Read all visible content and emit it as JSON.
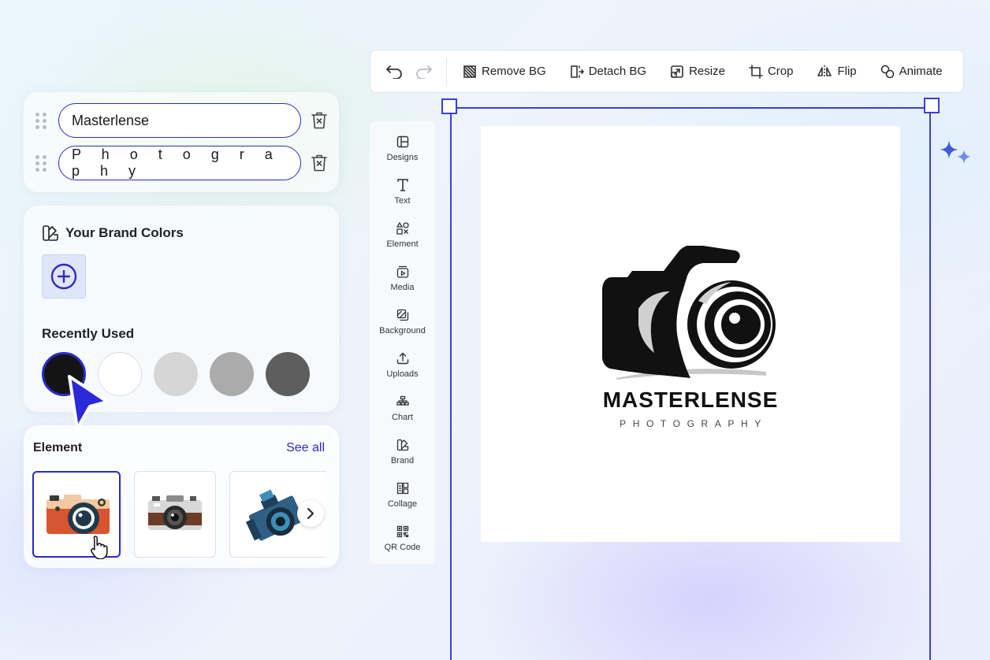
{
  "layers": {
    "items": [
      {
        "text": "Masterlense"
      },
      {
        "text": "P h o t o g r a p h y"
      }
    ]
  },
  "brand": {
    "title": "Your Brand Colors",
    "recent_title": "Recently Used",
    "recent_colors": [
      "#141414",
      "#ffffff",
      "#d6d6d6",
      "#ababab",
      "#5e5e5e"
    ]
  },
  "elements": {
    "title": "Element",
    "see_all": "See all"
  },
  "toolbar": {
    "remove_bg": "Remove BG",
    "detach_bg": "Detach BG",
    "resize": "Resize",
    "crop": "Crop",
    "flip": "Flip",
    "animate": "Animate"
  },
  "rail": {
    "items": [
      {
        "label": "Designs",
        "icon": "layout-icon"
      },
      {
        "label": "Text",
        "icon": "text-icon"
      },
      {
        "label": "Element",
        "icon": "shapes-icon"
      },
      {
        "label": "Media",
        "icon": "media-icon"
      },
      {
        "label": "Background",
        "icon": "background-icon"
      },
      {
        "label": "Uploads",
        "icon": "upload-icon"
      },
      {
        "label": "Chart",
        "icon": "chart-icon"
      },
      {
        "label": "Brand",
        "icon": "brand-icon"
      },
      {
        "label": "Collage",
        "icon": "collage-icon"
      },
      {
        "label": "QR Code",
        "icon": "qr-code-icon"
      }
    ]
  },
  "canvas": {
    "logo_title": "MASTERLENSE",
    "logo_subtitle": "PHOTOGRAPHY"
  },
  "colors": {
    "accent": "#2b2bc6",
    "selection": "#3b3fd8"
  }
}
